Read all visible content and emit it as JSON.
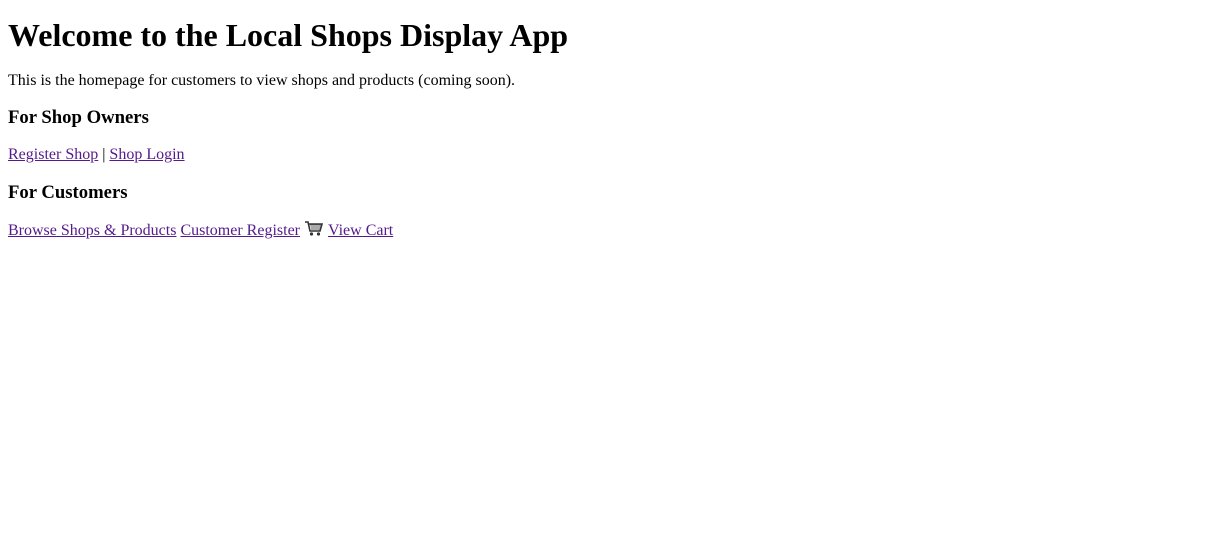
{
  "page": {
    "title": "Welcome to the Local Shops Display App",
    "intro": "This is the homepage for customers to view shops and products (coming soon)."
  },
  "owners": {
    "heading": "For Shop Owners",
    "register_link": "Register Shop",
    "separator": "|",
    "login_link": "Shop Login"
  },
  "customers": {
    "heading": "For Customers",
    "browse_link": "Browse Shops & Products",
    "register_link": "Customer Register",
    "cart_icon": "shopping-cart-icon",
    "cart_link": "View Cart"
  },
  "colors": {
    "link_visited": "#551a8b",
    "text": "#000000",
    "background": "#ffffff"
  }
}
